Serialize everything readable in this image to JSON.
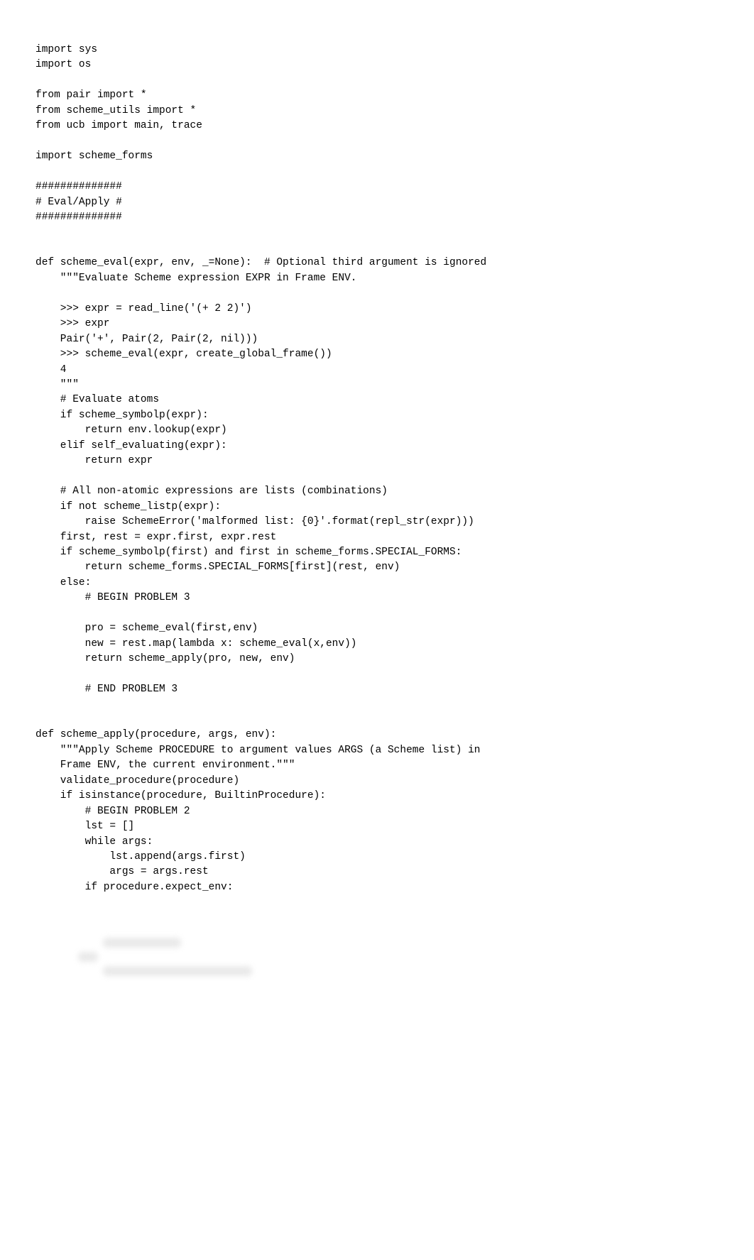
{
  "code": {
    "lines": [
      "import sys",
      "import os",
      "",
      "from pair import *",
      "from scheme_utils import *",
      "from ucb import main, trace",
      "",
      "import scheme_forms",
      "",
      "##############",
      "# Eval/Apply #",
      "##############",
      "",
      "",
      "def scheme_eval(expr, env, _=None):  # Optional third argument is ignored",
      "    \"\"\"Evaluate Scheme expression EXPR in Frame ENV.",
      "",
      "    >>> expr = read_line('(+ 2 2)')",
      "    >>> expr",
      "    Pair('+', Pair(2, Pair(2, nil)))",
      "    >>> scheme_eval(expr, create_global_frame())",
      "    4",
      "    \"\"\"",
      "    # Evaluate atoms",
      "    if scheme_symbolp(expr):",
      "        return env.lookup(expr)",
      "    elif self_evaluating(expr):",
      "        return expr",
      "",
      "    # All non-atomic expressions are lists (combinations)",
      "    if not scheme_listp(expr):",
      "        raise SchemeError('malformed list: {0}'.format(repl_str(expr)))",
      "    first, rest = expr.first, expr.rest",
      "    if scheme_symbolp(first) and first in scheme_forms.SPECIAL_FORMS:",
      "        return scheme_forms.SPECIAL_FORMS[first](rest, env)",
      "    else:",
      "        # BEGIN PROBLEM 3",
      "",
      "        pro = scheme_eval(first,env)",
      "        new = rest.map(lambda x: scheme_eval(x,env))",
      "        return scheme_apply(pro, new, env)",
      "",
      "        # END PROBLEM 3",
      "",
      "",
      "def scheme_apply(procedure, args, env):",
      "    \"\"\"Apply Scheme PROCEDURE to argument values ARGS (a Scheme list) in",
      "    Frame ENV, the current environment.\"\"\"",
      "    validate_procedure(procedure)",
      "    if isinstance(procedure, BuiltinProcedure):",
      "        # BEGIN PROBLEM 2",
      "        lst = []",
      "        while args:",
      "            lst.append(args.first)",
      "            args = args.rest",
      "        if procedure.expect_env:"
    ]
  },
  "blurred": {
    "line1_width": 110,
    "line1_indent": 95,
    "line2_width": 28,
    "line2_indent": 60,
    "line3_width": 210,
    "line3_indent": 95
  }
}
